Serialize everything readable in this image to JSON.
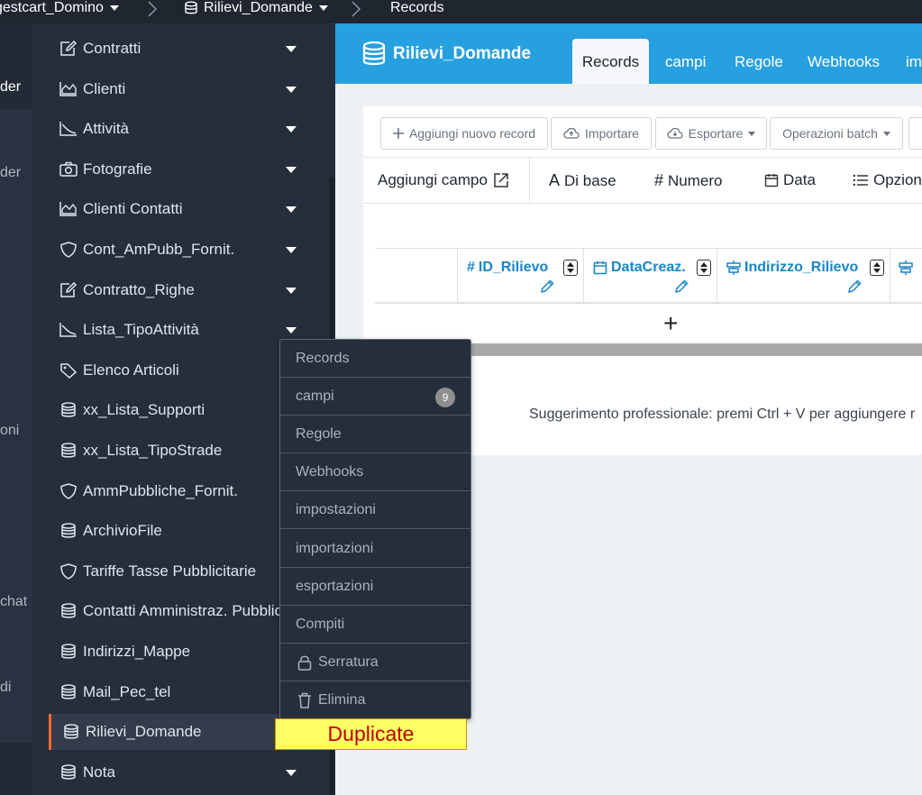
{
  "breadcrumb": {
    "app_name": "gestcart_Domino",
    "table_name": "Rilievi_Domande",
    "current": "Records"
  },
  "leftstrip": {
    "texts": [
      "der",
      "der",
      "oni",
      "chat",
      "di"
    ]
  },
  "sidebar": {
    "items": [
      {
        "label": "Contratti",
        "icon": "edit-icon",
        "caret": true
      },
      {
        "label": "Clienti",
        "icon": "area-chart-icon",
        "caret": true
      },
      {
        "label": "Attività",
        "icon": "line-chart-icon",
        "caret": true
      },
      {
        "label": "Fotografie",
        "icon": "camera-icon",
        "caret": true
      },
      {
        "label": "Clienti Contatti",
        "icon": "area-chart-icon",
        "caret": true
      },
      {
        "label": "Cont_AmPubb_Fornit.",
        "icon": "shield-icon",
        "caret": true
      },
      {
        "label": "Contratto_Righe",
        "icon": "edit-icon",
        "caret": true
      },
      {
        "label": "Lista_TipoAttività",
        "icon": "line-chart-icon",
        "caret": true
      },
      {
        "label": "Elenco Articoli",
        "icon": "tag-icon",
        "caret": false
      },
      {
        "label": "xx_Lista_Supporti",
        "icon": "database-icon",
        "caret": false
      },
      {
        "label": "xx_Lista_TipoStrade",
        "icon": "database-icon",
        "caret": false
      },
      {
        "label": "AmmPubbliche_Fornit.",
        "icon": "shield-icon",
        "caret": false
      },
      {
        "label": "ArchivioFile",
        "icon": "database-icon",
        "caret": false
      },
      {
        "label": "Tariffe Tasse Pubblicitarie",
        "icon": "shield-icon",
        "caret": false
      },
      {
        "label": "Contatti Amministraz. Pubblic",
        "icon": "database-icon",
        "caret": false
      },
      {
        "label": "Indirizzi_Mappe",
        "icon": "database-icon",
        "caret": false
      },
      {
        "label": "Mail_Pec_tel",
        "icon": "database-icon",
        "caret": false
      },
      {
        "label": "Rilievi_Domande",
        "icon": "database-icon",
        "caret": false,
        "active": true
      },
      {
        "label": "Nota",
        "icon": "database-icon",
        "caret": true
      }
    ]
  },
  "header": {
    "title": "Rilievi_Domande",
    "tabs": [
      "Records",
      "campi",
      "Regole",
      "Webhooks",
      "im"
    ]
  },
  "toolbar": {
    "add_record": "Aggiungi nuovo record",
    "import": "Importare",
    "export": "Esportare",
    "batch": "Operazioni batch"
  },
  "fieldbar": {
    "add_field": "Aggiungi campo",
    "basic": "Di base",
    "number": "Numero",
    "date": "Data",
    "options": "Opzione"
  },
  "columns": [
    "ID_Rilievo",
    "DataCreaz.",
    "Indirizzo_Rilievo"
  ],
  "addrow": {
    "plus": "+"
  },
  "tip": "Suggerimento professionale: premi Ctrl + V per aggiungere r",
  "context_menu": {
    "items": [
      {
        "label": "Records"
      },
      {
        "label": "campi",
        "badge": "9"
      },
      {
        "label": "Regole"
      },
      {
        "label": "Webhooks"
      },
      {
        "label": "impostazioni"
      },
      {
        "label": "importazioni"
      },
      {
        "label": "esportazioni"
      },
      {
        "label": "Compiti"
      },
      {
        "label": "Serratura",
        "icon": "lock-icon"
      },
      {
        "label": "Elimina",
        "icon": "trash-icon"
      }
    ]
  },
  "tooltip": "Duplicate",
  "colors": {
    "accent": "#27a0df",
    "sidebar_bg": "#252e3a",
    "active_border": "#ff6a2a",
    "column_text": "#1886c8",
    "tooltip_bg": "#ffff66",
    "tooltip_text": "#c00000"
  }
}
